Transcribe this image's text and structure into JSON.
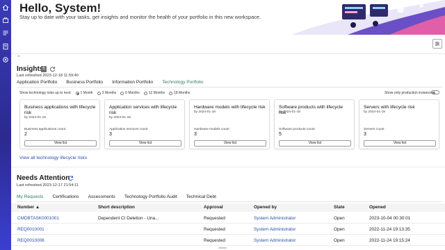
{
  "hero": {
    "greeting": "Hello, System!",
    "subtitle": "Stay up to date with your tasks, get insights and monitor the health of your portfolio in this new workspace."
  },
  "rail": {
    "icons": [
      "home-icon",
      "briefcase-icon",
      "list-icon",
      "document-icon",
      "gear-icon"
    ]
  },
  "insights": {
    "title": "Insights",
    "count": "5",
    "last_refreshed": "Last refreshed 2023-12-18 11:59:40",
    "tabs": [
      "Application Portfolio",
      "Business Portfolio",
      "Information Portfolio",
      "Technology Portfolio"
    ],
    "active_tab": "Technology Portfolio",
    "risk_label": "Show technology risks up to next:",
    "risk_options": [
      "1 Month",
      "3 Months",
      "6 Months",
      "12 Months",
      "18 Months"
    ],
    "risk_selected": "1 Month",
    "production_only_label": "Show only production instances",
    "cards": [
      {
        "title": "Business applications with lifecycle risk",
        "date": "by 2024-01-18",
        "count_label": "Business applications count",
        "count": "2",
        "button": "View list"
      },
      {
        "title": "Application services with lifecycle risk",
        "date": "by 2024-01-18",
        "count_label": "Application services count",
        "count": "3",
        "button": "View list"
      },
      {
        "title": "Hardware models with lifecycle risk",
        "date": "by 2024-01-18",
        "count_label": "Hardware models count",
        "count": "3",
        "button": "View list"
      },
      {
        "title": "Software products with lifecycle risk",
        "date": "by 2024-01-18",
        "count_label": "Software products count",
        "count": "5",
        "button": "View list"
      },
      {
        "title": "Servers with lifecycle risk",
        "date": "by 2024-01-18",
        "count_label": "Servers count",
        "count": "3",
        "button": "View list"
      }
    ],
    "view_all": "View all technology lifecycle risks"
  },
  "needs_attention": {
    "title": "Needs Attention",
    "last_refreshed": "Last refreshed 2023-12-17 21:54:11",
    "tabs": [
      "My Requests",
      "Certifications",
      "Assessments",
      "Technology Portfolio Audit",
      "Technical Debt"
    ],
    "active_tab": "My Requests",
    "columns": [
      "Number ▲",
      "Short description",
      "Approval",
      "Opened by",
      "State",
      "Opened"
    ],
    "rows": [
      [
        "CMDBTASK0001001",
        "Dependent CI Deletion - Una...",
        "Requested",
        "System Administrator",
        "Open",
        "2023-10-04 00:30:01"
      ],
      [
        "REQ0010001",
        "",
        "Requested",
        "System Administrator",
        "Open",
        "2022-11-24 19:13:35"
      ],
      [
        "REQ0010006",
        "",
        "Requested",
        "System Administrator",
        "Open",
        "2022-11-24 19:15:24"
      ]
    ]
  },
  "colors": {
    "rail": "#2b2a8f",
    "accent_green": "#2e7d5b",
    "link_blue": "#2b4ea8"
  }
}
